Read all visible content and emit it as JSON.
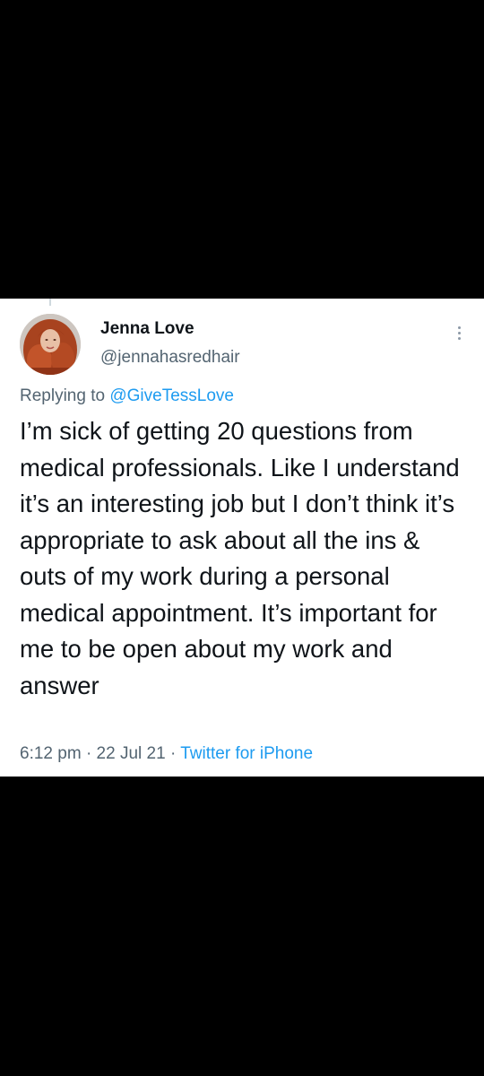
{
  "tweet": {
    "author": {
      "display_name": "Jenna Love",
      "handle": "@jennahasredhair"
    },
    "replying_prefix": "Replying to",
    "replying_to": "@GiveTessLove",
    "text": "I’m sick of getting 20 questions from medical professionals. Like I understand it’s an interesting job but I don’t think it’s appropriate to ask about all the ins & outs of my work during a personal medical appointment. It’s important for me to be open about my work and answer",
    "time": "6:12 pm",
    "date": "22 Jul 21",
    "separator": "·",
    "source": "Twitter for iPhone"
  },
  "icons": {
    "more": "more-vertical-icon"
  },
  "colors": {
    "background": "#000000",
    "card": "#ffffff",
    "link": "#1d9bf0",
    "secondary_text": "#536471",
    "primary_text": "#0f1419"
  }
}
